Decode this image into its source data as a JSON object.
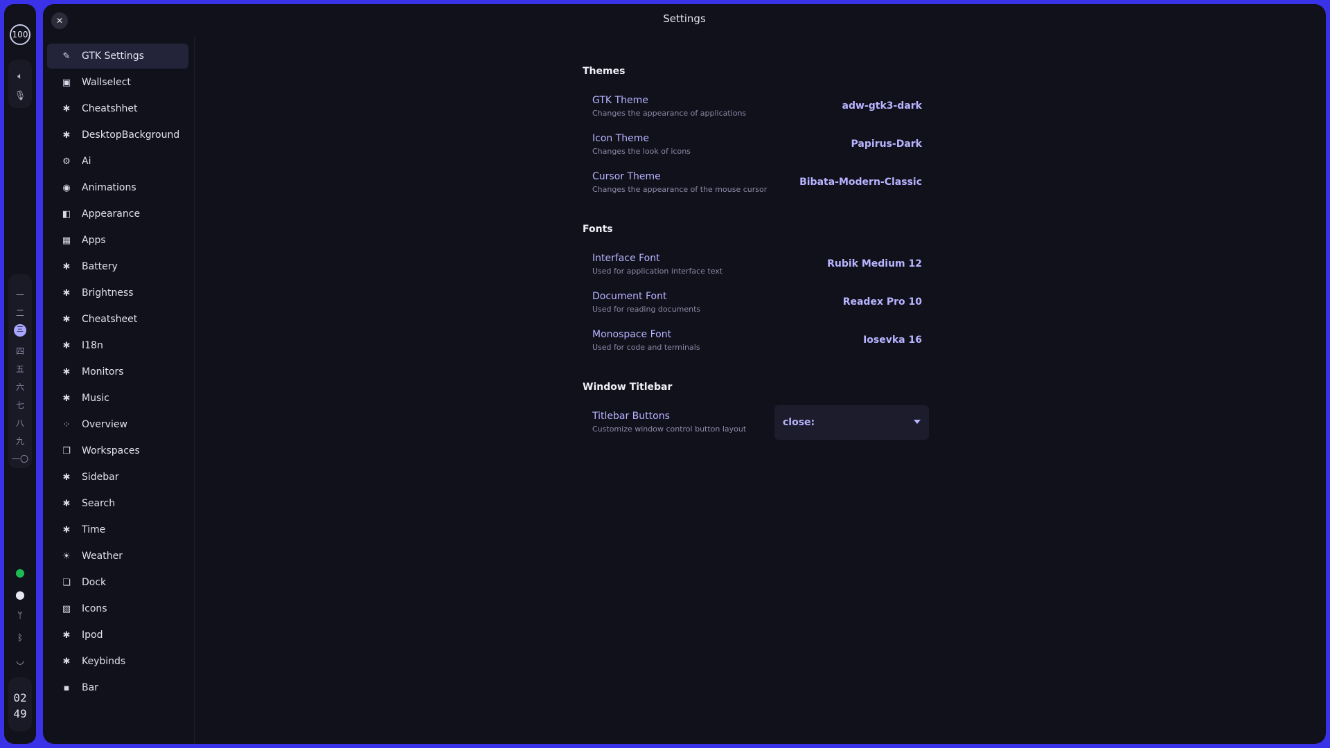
{
  "leftbar": {
    "badge": "100",
    "workspaces": [
      "一",
      "二",
      "三",
      "四",
      "五",
      "六",
      "七",
      "八",
      "九",
      "一〇"
    ],
    "active_workspace": 2,
    "clock_hour": "02",
    "clock_minute": "49",
    "colors": {
      "spotify": "#1db954",
      "accent": "#a9a6ff"
    }
  },
  "window": {
    "title": "Settings",
    "close_icon": "close-icon"
  },
  "nav": {
    "items": [
      {
        "label": "GTK Settings",
        "icon": "brush-icon",
        "glyph": "✎",
        "active": true
      },
      {
        "label": "Wallselect",
        "icon": "monitor-icon",
        "glyph": "▣"
      },
      {
        "label": "Cheatshhet",
        "icon": "puzzle-icon",
        "glyph": "✱"
      },
      {
        "label": "DesktopBackground",
        "icon": "puzzle-icon",
        "glyph": "✱"
      },
      {
        "label": "Ai",
        "icon": "gear-icon",
        "glyph": "⚙"
      },
      {
        "label": "Animations",
        "icon": "eye-icon",
        "glyph": "◉"
      },
      {
        "label": "Appearance",
        "icon": "palette-icon",
        "glyph": "◧"
      },
      {
        "label": "Apps",
        "icon": "apps-icon",
        "glyph": "▦"
      },
      {
        "label": "Battery",
        "icon": "puzzle-icon",
        "glyph": "✱"
      },
      {
        "label": "Brightness",
        "icon": "puzzle-icon",
        "glyph": "✱"
      },
      {
        "label": "Cheatsheet",
        "icon": "puzzle-icon",
        "glyph": "✱"
      },
      {
        "label": "I18n",
        "icon": "puzzle-icon",
        "glyph": "✱"
      },
      {
        "label": "Monitors",
        "icon": "puzzle-icon",
        "glyph": "✱"
      },
      {
        "label": "Music",
        "icon": "puzzle-icon",
        "glyph": "✱"
      },
      {
        "label": "Overview",
        "icon": "grid-dots-icon",
        "glyph": "⁘"
      },
      {
        "label": "Workspaces",
        "icon": "windows-icon",
        "glyph": "❐"
      },
      {
        "label": "Sidebar",
        "icon": "puzzle-icon",
        "glyph": "✱"
      },
      {
        "label": "Search",
        "icon": "puzzle-icon",
        "glyph": "✱"
      },
      {
        "label": "Time",
        "icon": "puzzle-icon",
        "glyph": "✱"
      },
      {
        "label": "Weather",
        "icon": "weather-icon",
        "glyph": "☀"
      },
      {
        "label": "Dock",
        "icon": "copy-icon",
        "glyph": "❏"
      },
      {
        "label": "Icons",
        "icon": "image-icon",
        "glyph": "▨"
      },
      {
        "label": "Ipod",
        "icon": "puzzle-icon",
        "glyph": "✱"
      },
      {
        "label": "Keybinds",
        "icon": "puzzle-icon",
        "glyph": "✱"
      },
      {
        "label": "Bar",
        "icon": "grid-icon",
        "glyph": "▪"
      }
    ]
  },
  "content": {
    "themes": {
      "title": "Themes",
      "rows": [
        {
          "label": "GTK Theme",
          "desc": "Changes the appearance of applications",
          "value": "adw-gtk3-dark"
        },
        {
          "label": "Icon Theme",
          "desc": "Changes the look of icons",
          "value": "Papirus-Dark"
        },
        {
          "label": "Cursor Theme",
          "desc": "Changes the appearance of the mouse cursor",
          "value": "Bibata-Modern-Classic"
        }
      ]
    },
    "fonts": {
      "title": "Fonts",
      "rows": [
        {
          "label": "Interface Font",
          "desc": "Used for application interface text",
          "value": "Rubik Medium 12"
        },
        {
          "label": "Document Font",
          "desc": "Used for reading documents",
          "value": "Readex Pro 10"
        },
        {
          "label": "Monospace Font",
          "desc": "Used for code and terminals",
          "value": "Iosevka 16"
        }
      ]
    },
    "titlebar": {
      "title": "Window Titlebar",
      "row": {
        "label": "Titlebar Buttons",
        "desc": "Customize window control button layout"
      },
      "dropdown_value": "close:"
    }
  }
}
